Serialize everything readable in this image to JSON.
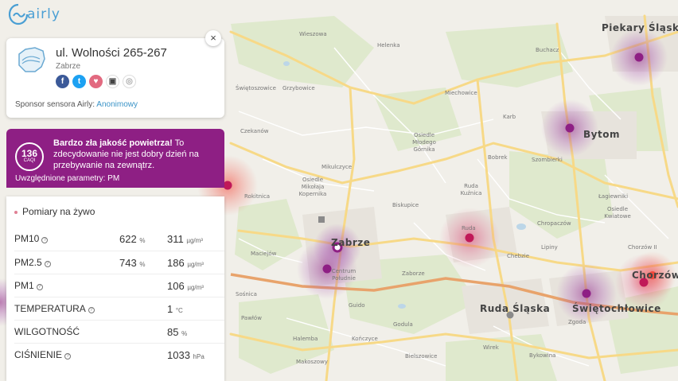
{
  "logo": {
    "text": "airly"
  },
  "card": {
    "close": "×",
    "title": "ul. Wolności 265-267",
    "city": "Zabrze",
    "social": [
      {
        "name": "facebook-icon",
        "glyph": "f",
        "color": "#3b5998"
      },
      {
        "name": "twitter-icon",
        "glyph": "t",
        "color": "#1da1f2"
      },
      {
        "name": "heart-icon",
        "glyph": "♥",
        "color": "#e26a80"
      },
      {
        "name": "embed-icon",
        "glyph": "▣",
        "color": "#444444"
      },
      {
        "name": "locate-icon",
        "glyph": "◎",
        "color": "#cccccc"
      }
    ],
    "sponsor_label": "Sponsor sensora Airly: ",
    "sponsor_name": "Anonimowy"
  },
  "banner": {
    "color": "#8e1f84",
    "caqi_value": "136",
    "caqi_unit": "CAQI",
    "headline": "Bardzo zła jakość powietrza!",
    "message": " To zdecydowanie nie jest dobry dzień na przebywanie na zewnątrz.",
    "params": "Uwzględnione parametry: PM"
  },
  "measurements": {
    "title": "Pomiary na żywo",
    "rows": [
      {
        "name": "PM10",
        "help": true,
        "pct": "622",
        "pct_unit": "%",
        "value": "311",
        "unit": "µg/m³"
      },
      {
        "name": "PM2.5",
        "help": true,
        "pct": "743",
        "pct_unit": "%",
        "value": "186",
        "unit": "µg/m³"
      },
      {
        "name": "PM1",
        "help": true,
        "pct": "",
        "pct_unit": "",
        "value": "106",
        "unit": "µg/m³"
      },
      {
        "name": "TEMPERATURA",
        "help": true,
        "pct": "",
        "pct_unit": "",
        "value": "1",
        "unit": "°C"
      },
      {
        "name": "WILGOTNOŚĆ",
        "help": false,
        "pct": "",
        "pct_unit": "",
        "value": "85",
        "unit": "%"
      },
      {
        "name": "CIŚNIENIE",
        "help": true,
        "pct": "",
        "pct_unit": "",
        "value": "1033",
        "unit": "hPa"
      }
    ]
  },
  "map": {
    "cities": [
      "Zabrze",
      "Bytom",
      "Ruda Śląska",
      "Świętochłowice",
      "Chorzów",
      "Piekary Śląskie"
    ],
    "districts": [
      "Wieszowa",
      "Helenka",
      "Buchacz",
      "Świętoszowice",
      "Grzybowice",
      "Miechowice",
      "Czekanów",
      "Karb",
      "Osiedle Młodego Górnika",
      "Mikulczyce",
      "Osiedle Mikołaja Kopernika",
      "Bobrek",
      "Szombierki",
      "Łagiewniki",
      "Osiedle Kwiatowe",
      "Rokitnica",
      "Biskupice",
      "Ruda Kuźnica",
      "Ruda",
      "Chropaczów",
      "Maciejów",
      "Lipiny",
      "Chebzie",
      "Chorzów II",
      "Centrum Południe",
      "Zaborze",
      "Guido",
      "Pawłów",
      "Godula",
      "Zgoda",
      "Sośnica",
      "Halemba",
      "Kończyce",
      "Wirek",
      "Bykowina",
      "Makoszowy",
      "Bielszowice"
    ]
  },
  "sensors": [
    {
      "name": "sensor-piekary",
      "level": "very-bad",
      "color": "#8e1f84"
    },
    {
      "name": "sensor-bytom",
      "level": "very-bad",
      "color": "#8e1f84"
    },
    {
      "name": "sensor-zabrze-active",
      "level": "very-bad",
      "color": "#8e1f84"
    },
    {
      "name": "sensor-centrum-poludnie",
      "level": "very-bad",
      "color": "#8e1f84"
    },
    {
      "name": "sensor-ruda",
      "level": "bad",
      "color": "#d6235c"
    },
    {
      "name": "sensor-swietochlowice",
      "level": "very-bad",
      "color": "#8e1f84"
    },
    {
      "name": "sensor-chorzow-1",
      "level": "bad",
      "color": "#d6235c"
    },
    {
      "name": "sensor-chorzow-2",
      "level": "bad",
      "color": "#f25252"
    },
    {
      "name": "sensor-west-edge",
      "level": "bad",
      "color": "#d6235c"
    }
  ]
}
